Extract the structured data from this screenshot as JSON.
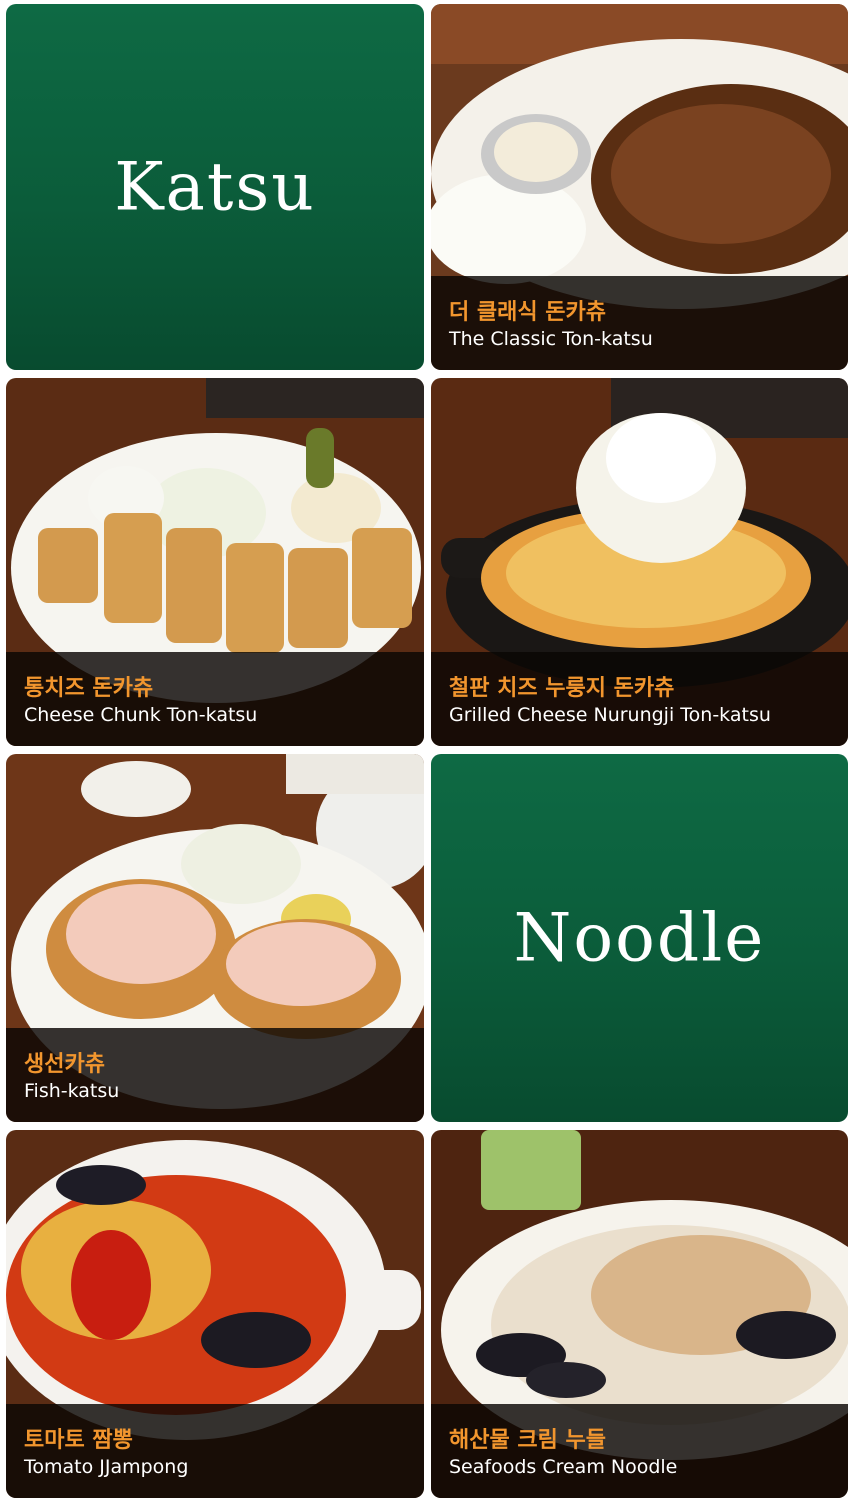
{
  "categories": {
    "katsu": "Katsu",
    "noodle": "Noodle"
  },
  "menu_items": [
    {
      "name_ko": "더 클래식 돈카츄",
      "name_en": "The Classic Ton-katsu"
    },
    {
      "name_ko": "통치즈 돈카츄",
      "name_en": "Cheese Chunk Ton-katsu"
    },
    {
      "name_ko": "철판 치즈 누룽지 돈카츄",
      "name_en": "Grilled Cheese Nurungji Ton-katsu"
    },
    {
      "name_ko": "생선카츄",
      "name_en": "Fish-katsu"
    },
    {
      "name_ko": "토마토 짬뽕",
      "name_en": "Tomato JJampong"
    },
    {
      "name_ko": "해산물 크림 누들",
      "name_en": "Seafoods Cream Noodle"
    }
  ],
  "colors": {
    "category_green": "#0b5c3a",
    "caption_korean": "#f2962e",
    "caption_english": "#ffffff"
  }
}
